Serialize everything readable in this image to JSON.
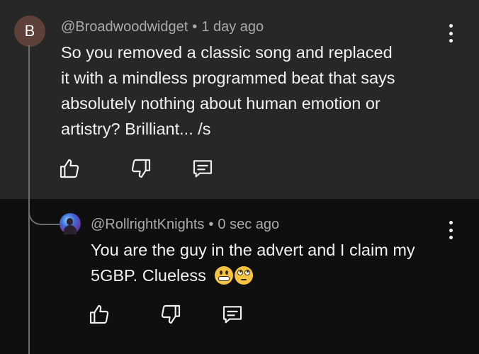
{
  "parent_comment": {
    "avatar_letter": "B",
    "author": "@Broadwoodwidget",
    "separator": "•",
    "time": "1 day ago",
    "text_lines": [
      "So you removed a classic song and replaced",
      "it with a mindless programmed beat that says",
      "absolutely nothing about human emotion or",
      "artistry? Brilliant... /s"
    ],
    "avatar_color": "#5d4037"
  },
  "reply_comment": {
    "author": "@RollrightKnights",
    "separator": "•",
    "time": "0 sec ago",
    "text_lines": [
      "You are the guy in the advert and I claim my",
      "5GBP. Clueless"
    ],
    "emojis": [
      "grimacing-face",
      "face-with-rolling-eyes"
    ]
  },
  "icons": {
    "like": "thumbs-up-icon",
    "dislike": "thumbs-down-icon",
    "reply": "comment-icon",
    "menu": "more-vert-icon"
  },
  "colors": {
    "parent_background": "#272727",
    "page_background": "#0f0f0f",
    "meta_text": "#aaaaaa",
    "body_text": "#f1f1f1"
  }
}
